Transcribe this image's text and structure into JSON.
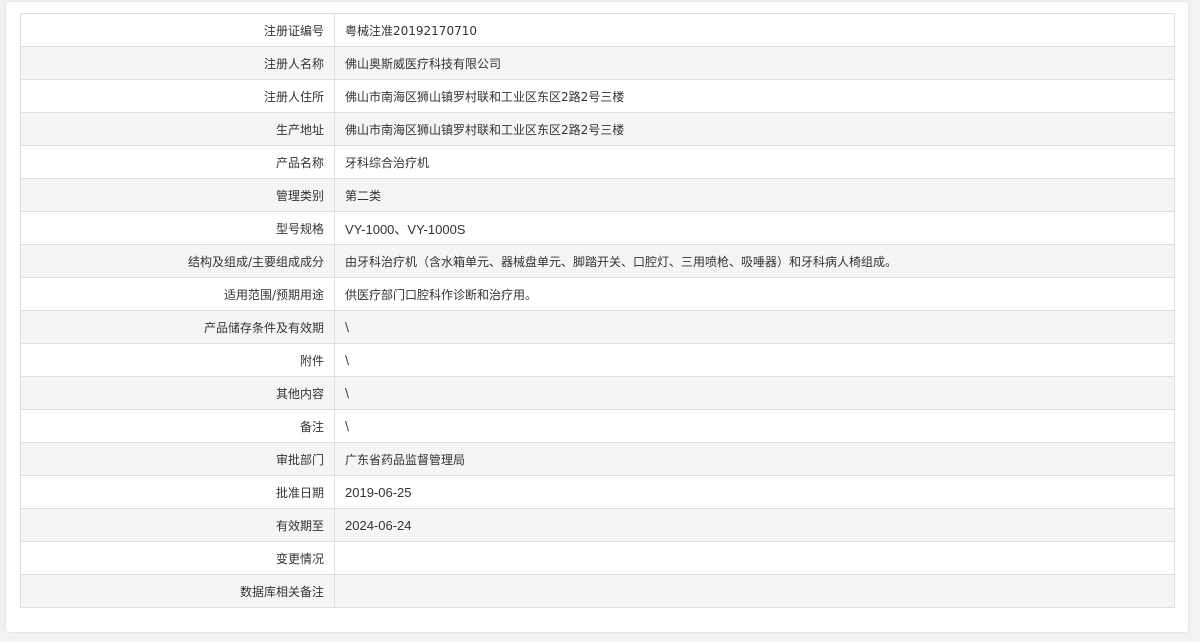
{
  "record": {
    "rows": [
      {
        "label": "注册证编号",
        "value": "粤械注准20192170710"
      },
      {
        "label": "注册人名称",
        "value": "佛山奥斯威医疗科技有限公司"
      },
      {
        "label": "注册人住所",
        "value": "佛山市南海区狮山镇罗村联和工业区东区2路2号三楼"
      },
      {
        "label": "生产地址",
        "value": "佛山市南海区狮山镇罗村联和工业区东区2路2号三楼"
      },
      {
        "label": "产品名称",
        "value": "牙科综合治疗机"
      },
      {
        "label": "管理类别",
        "value": "第二类"
      },
      {
        "label": "型号规格",
        "value": "VY-1000、VY-1000S"
      },
      {
        "label": "结构及组成/主要组成成分",
        "value": "由牙科治疗机（含水箱单元、器械盘单元、脚踏开关、口腔灯、三用喷枪、吸唾器）和牙科病人椅组成。"
      },
      {
        "label": "适用范围/预期用途",
        "value": "供医疗部门口腔科作诊断和治疗用。"
      },
      {
        "label": "产品储存条件及有效期",
        "value": "\\"
      },
      {
        "label": "附件",
        "value": "\\"
      },
      {
        "label": "其他内容",
        "value": "\\"
      },
      {
        "label": "备注",
        "value": "\\"
      },
      {
        "label": "审批部门",
        "value": "广东省药品监督管理局"
      },
      {
        "label": "批准日期",
        "value": "2019-06-25"
      },
      {
        "label": "有效期至",
        "value": "2024-06-24"
      },
      {
        "label": "变更情况",
        "value": ""
      },
      {
        "label": "数据库相关备注",
        "value": ""
      }
    ]
  },
  "colors": {
    "background": "#f2f2f2",
    "card": "#ffffff",
    "row_alt": "#f5f5f5",
    "border": "#dedede",
    "text": "#333333"
  }
}
